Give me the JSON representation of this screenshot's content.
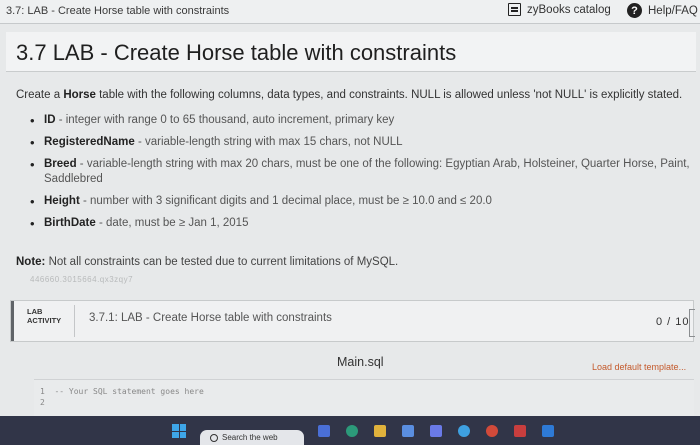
{
  "topbar": {
    "breadcrumb": "3.7: LAB - Create Horse table with constraints",
    "catalog_label": "zyBooks catalog",
    "help_label": "Help/FAQ",
    "help_icon_glyph": "?"
  },
  "page": {
    "title": "3.7 LAB - Create Horse table with constraints",
    "intro_prefix": "Create a ",
    "intro_table": "Horse",
    "intro_suffix": " table with the following columns, data types, and constraints. NULL is allowed unless 'not NULL' is explicitly stated.",
    "requirements": [
      {
        "name": "ID",
        "desc": " - integer with range 0 to 65 thousand, auto increment, primary key"
      },
      {
        "name": "RegisteredName",
        "desc": " - variable-length string with max 15 chars, not NULL"
      },
      {
        "name": "Breed",
        "desc": " - variable-length string with max 20 chars, must be one of the following: Egyptian Arab, Holsteiner, Quarter Horse, Paint, Saddlebred"
      },
      {
        "name": "Height",
        "desc": " - number with 3 significant digits and 1 decimal place, must be ≥ 10.0 and ≤ 20.0"
      },
      {
        "name": "BirthDate",
        "desc": " - date, must be ≥ Jan 1, 2015"
      }
    ],
    "note_label": "Note:",
    "note_text": " Not all constraints can be tested due to current limitations of MySQL.",
    "watermark": "446660.3015664.qx3zqy7"
  },
  "lab": {
    "tag_line1": "LAB",
    "tag_line2": "ACTIVITY",
    "title": "3.7.1: LAB - Create Horse table with constraints",
    "score": "0 / 10"
  },
  "editor": {
    "filename": "Main.sql",
    "load_template": "Load default template...",
    "lines": [
      {
        "num": "1",
        "text": "-- Your SQL statement goes here"
      },
      {
        "num": "2",
        "text": ""
      }
    ]
  },
  "taskbar": {
    "search_placeholder": "Search the web"
  },
  "colors": {
    "accent_link": "#c45a2c",
    "taskbar": "#313548",
    "windows_logo": "#3ea6e8"
  }
}
